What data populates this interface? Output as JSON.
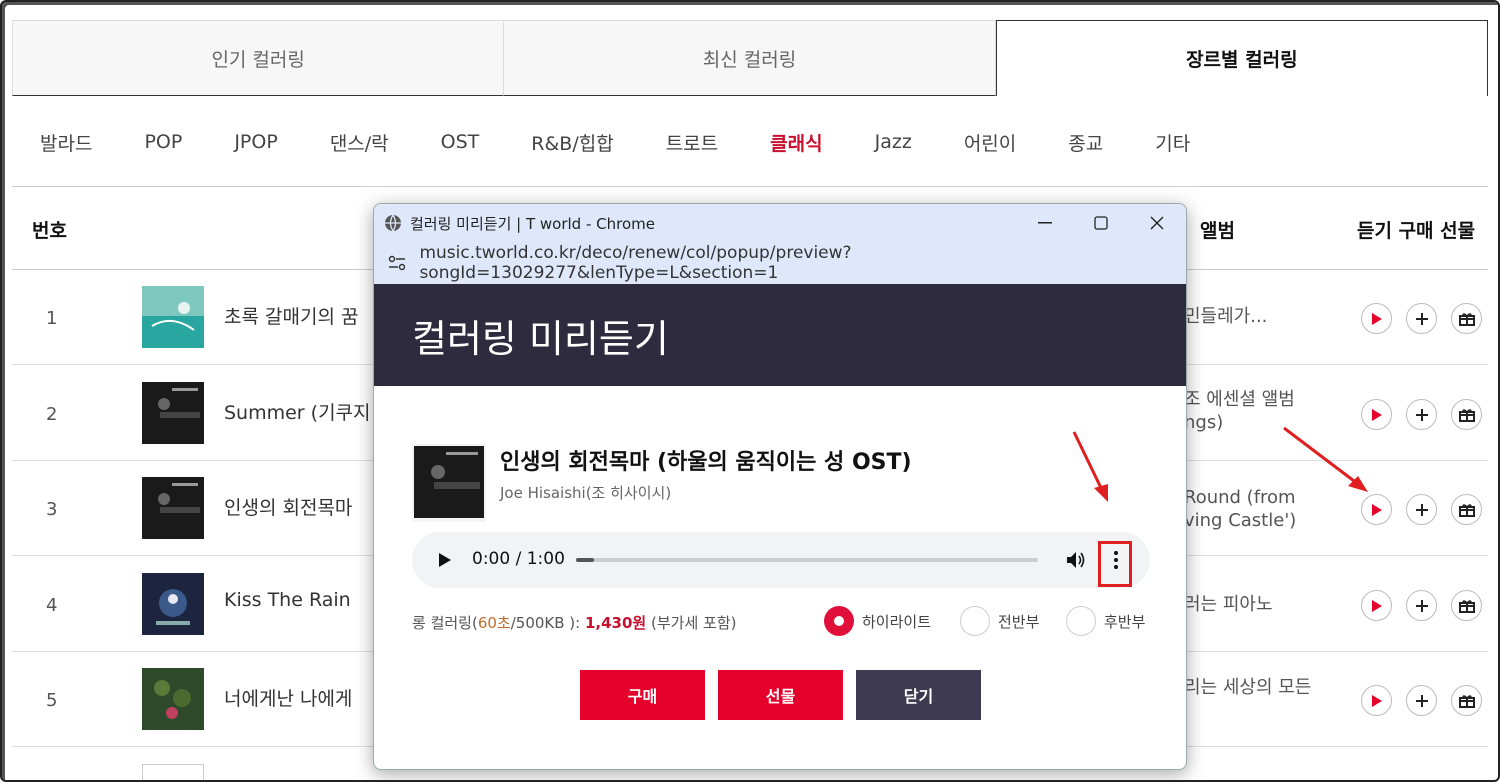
{
  "tabs": [
    "인기 컬러링",
    "최신 컬러링",
    "장르별 컬러링"
  ],
  "genres": [
    "발라드",
    "POP",
    "JPOP",
    "댄스/락",
    "OST",
    "R&B/힙합",
    "트로트",
    "클래식",
    "Jazz",
    "어린이",
    "종교",
    "기타"
  ],
  "active_genre": "클래식",
  "table_header": {
    "num": "번호",
    "album": "앨범",
    "actions": "듣기 구매 선물"
  },
  "rows": [
    {
      "num": "1",
      "title": "초록 갈매기의 꿈",
      "album": "민들레가..."
    },
    {
      "num": "2",
      "title": "Summer (기쿠지",
      "album": "조 에센셜 앨범\nngs)"
    },
    {
      "num": "3",
      "title": "인생의 회전목마",
      "album": "Round (from\nving Castle')"
    },
    {
      "num": "4",
      "title": "Kiss The Rain",
      "album": "러는 피아노"
    },
    {
      "num": "5",
      "title": "너에게난 나에게",
      "album": "리는 세상의 모든"
    }
  ],
  "popup": {
    "window_title": "컬러링 미리듣기 | T world - Chrome",
    "url": "music.tworld.co.kr/deco/renew/col/popup/preview?songId=13029277&lenType=L&section=1",
    "header": "컬러링 미리듣기",
    "song_title": "인생의 회전목마 (하울의 움직이는 성 OST)",
    "artist": "Joe Hisaishi(조 히사이시)",
    "time": "0:00 / 1:00",
    "progress": 0.04,
    "price_prefix": "롱 컬러링(",
    "duration": "60초",
    "price_mid": "/500KB ): ",
    "price": "1,430원",
    "price_suffix": " (부가세 포함)",
    "options": [
      "하이라이트",
      "전반부",
      "후반부"
    ],
    "selected_option": "하이라이트",
    "buttons": {
      "buy": "구매",
      "gift": "선물",
      "close": "닫기"
    }
  },
  "colors": {
    "accent": "#e4002b",
    "header_bg": "#2f2b3e",
    "annotation": "#e02020"
  }
}
